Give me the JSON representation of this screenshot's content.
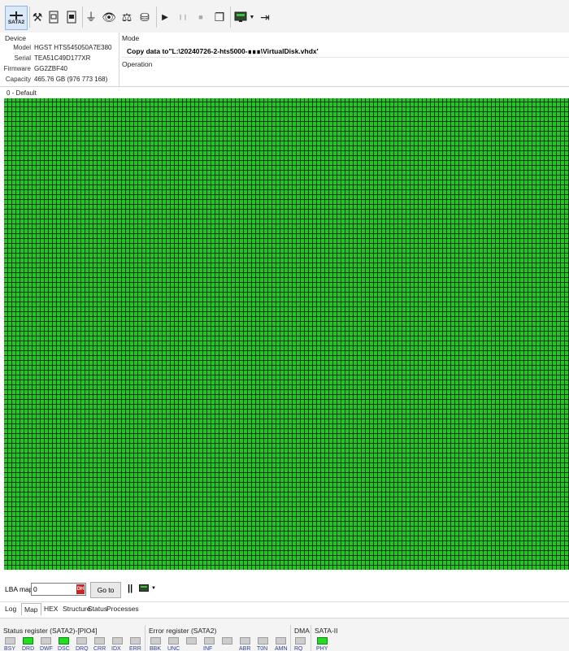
{
  "toolbar": {
    "sata_label": "SATA2",
    "buttons": [
      {
        "name": "tools-icon",
        "glyph": "⚒"
      },
      {
        "name": "sd-card-icon",
        "glyph": "🂠"
      },
      {
        "name": "chip-card-icon",
        "glyph": "🂠"
      },
      {
        "name": "plug-icon",
        "glyph": "⏚"
      },
      {
        "name": "binoculars-icon",
        "glyph": "👁"
      },
      {
        "name": "scale-icon",
        "glyph": "⚖"
      },
      {
        "name": "disk-copy-icon",
        "glyph": "⛁"
      },
      {
        "name": "play-icon",
        "glyph": "▶"
      },
      {
        "name": "pause-icon",
        "glyph": "❙❙"
      },
      {
        "name": "stop-icon",
        "glyph": "■"
      },
      {
        "name": "copy-file-icon",
        "glyph": "❐"
      },
      {
        "name": "monitor-icon",
        "glyph": "▣"
      },
      {
        "name": "exit-icon",
        "glyph": "⇥"
      }
    ]
  },
  "device": {
    "title": "Device",
    "rows": [
      {
        "key": "Model",
        "value": "HGST HTS545050A7E380"
      },
      {
        "key": "Serial",
        "value": "TEA51C49D177XR"
      },
      {
        "key": "Firmware",
        "value": "GG2ZBF40"
      },
      {
        "key": "Capacity",
        "value": "465.76 GB (976 773 168)"
      }
    ]
  },
  "mode": {
    "title": "Mode",
    "value": "Copy data to\"L:\\20240726-2-hts5000-∎∎∎\\VirtualDisk.vhdx'",
    "operation_label": "Operation"
  },
  "map": {
    "title": "0 - Default",
    "colors": {
      "good": "#1fc81f",
      "grid": "#0d360d"
    }
  },
  "lba": {
    "label": "LBA map",
    "value": "0",
    "dh_badge": "DH",
    "goto_label": "Go to",
    "pause_glyph": "||"
  },
  "tabs": [
    {
      "label": "Log",
      "active": false
    },
    {
      "label": "Map",
      "active": true
    },
    {
      "label": "HEX",
      "active": false
    },
    {
      "label": "Structure",
      "active": false
    },
    {
      "label": "Status",
      "active": false
    },
    {
      "label": "Processes",
      "active": false
    }
  ],
  "status": {
    "status_title": "Status register (SATA2)-[PIO4]",
    "status_leds": [
      {
        "label": "BSY",
        "on": false
      },
      {
        "label": "DRD",
        "on": true
      },
      {
        "label": "DWF",
        "on": false
      },
      {
        "label": "DSC",
        "on": true
      },
      {
        "label": "DRQ",
        "on": false
      },
      {
        "label": "CRR",
        "on": false
      },
      {
        "label": "IDX",
        "on": false
      },
      {
        "label": "ERR",
        "on": false
      }
    ],
    "error_title": "Error register (SATA2)",
    "error_leds": [
      {
        "label": "BBK",
        "on": false
      },
      {
        "label": "UNC",
        "on": false
      },
      {
        "label": "",
        "on": false
      },
      {
        "label": "INF",
        "on": false
      },
      {
        "label": "",
        "on": false
      },
      {
        "label": "ABR",
        "on": false
      },
      {
        "label": "T0N",
        "on": false
      },
      {
        "label": "AMN",
        "on": false
      }
    ],
    "dma_title": "DMA",
    "dma_leds": [
      {
        "label": "RQ",
        "on": false
      }
    ],
    "sata_title": "SATA-II",
    "sata_leds": [
      {
        "label": "PHY",
        "on": true
      }
    ]
  }
}
